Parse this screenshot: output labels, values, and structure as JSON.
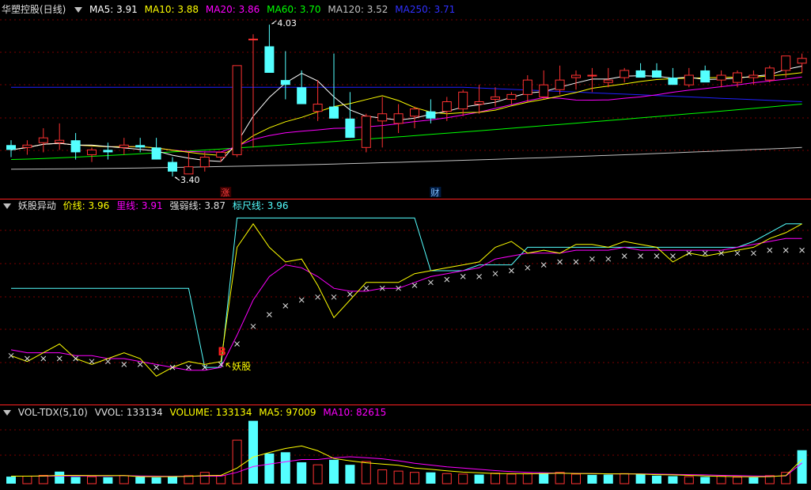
{
  "colors": {
    "bg": "#000000",
    "up": "#ff3232",
    "down": "#54ffff",
    "ma5": "#ffffff",
    "ma10": "#ffff00",
    "ma20": "#ff00ff",
    "ma60": "#00ff00",
    "ma120": "#c0c0c0",
    "ma250": "#2020ff",
    "divider": "#ff2020"
  },
  "panel1": {
    "title": "华塑控股(日线)",
    "ma5_label": "MA5: 3.91",
    "ma10_label": "MA10: 3.88",
    "ma20_label": "MA20: 3.86",
    "ma60_label": "MA60: 3.70",
    "ma120_label": "MA120: 3.52",
    "ma250_label": "MA250: 3.71",
    "high_label": "4.03",
    "low_label": "3.40",
    "marker_zhang": "涨",
    "marker_cai": "财"
  },
  "panel2": {
    "title": "妖股异动",
    "price_label": "价线: 3.96",
    "li_label": "里线: 3.91",
    "qiang_label": "强弱线: 3.87",
    "biao_label": "标尺线: 3.96",
    "signal_b": "B",
    "signal_text": "妖股"
  },
  "panel3": {
    "title": "VOL-TDX(5,10)",
    "vvol_label": "VVOL: 133134",
    "volume_label": "VOLUME: 133134",
    "ma5_label": "MA5: 97009",
    "ma10_label": "MA10: 82615"
  },
  "chart_data": [
    {
      "type": "candlestick",
      "title": "华塑控股(日线)",
      "x_index": [
        0,
        1,
        2,
        3,
        4,
        5,
        6,
        7,
        8,
        9,
        10,
        11,
        12,
        13,
        14,
        15,
        16,
        17,
        18,
        19,
        20,
        21,
        22,
        23,
        24,
        25,
        26,
        27,
        28,
        29,
        30,
        31,
        32,
        33,
        34,
        35,
        36,
        37,
        38,
        39,
        40,
        41,
        42,
        43,
        44,
        45,
        46,
        47,
        48,
        49
      ],
      "open": [
        3.53,
        3.52,
        3.54,
        3.54,
        3.55,
        3.49,
        3.51,
        3.52,
        3.53,
        3.52,
        3.46,
        3.41,
        3.44,
        3.48,
        3.49,
        3.97,
        3.94,
        3.8,
        3.77,
        3.67,
        3.69,
        3.64,
        3.52,
        3.63,
        3.62,
        3.65,
        3.67,
        3.67,
        3.68,
        3.7,
        3.72,
        3.72,
        3.74,
        3.73,
        3.76,
        3.81,
        3.82,
        3.79,
        3.81,
        3.84,
        3.84,
        3.81,
        3.78,
        3.84,
        3.8,
        3.79,
        3.81,
        3.8,
        3.84,
        3.87
      ],
      "high": [
        3.55,
        3.55,
        3.6,
        3.62,
        3.58,
        3.52,
        3.54,
        3.56,
        3.56,
        3.56,
        3.48,
        3.5,
        3.5,
        3.5,
        3.86,
        3.99,
        4.03,
        3.92,
        3.84,
        3.8,
        3.91,
        3.75,
        3.66,
        3.73,
        3.7,
        3.69,
        3.72,
        3.73,
        3.76,
        3.78,
        3.77,
        3.75,
        3.82,
        3.84,
        3.86,
        3.84,
        3.85,
        3.85,
        3.85,
        3.87,
        3.87,
        3.85,
        3.85,
        3.86,
        3.84,
        3.84,
        3.84,
        3.86,
        3.89,
        3.91
      ],
      "low": [
        3.48,
        3.49,
        3.5,
        3.51,
        3.47,
        3.46,
        3.47,
        3.49,
        3.5,
        3.47,
        3.4,
        3.41,
        3.42,
        3.46,
        3.48,
        3.52,
        3.85,
        3.72,
        3.71,
        3.63,
        3.64,
        3.56,
        3.5,
        3.52,
        3.58,
        3.6,
        3.62,
        3.63,
        3.65,
        3.66,
        3.69,
        3.7,
        3.71,
        3.72,
        3.74,
        3.76,
        3.75,
        3.77,
        3.79,
        3.82,
        3.81,
        3.78,
        3.77,
        3.8,
        3.77,
        3.77,
        3.78,
        3.79,
        3.81,
        3.83
      ],
      "close": [
        3.51,
        3.53,
        3.56,
        3.55,
        3.5,
        3.51,
        3.5,
        3.53,
        3.52,
        3.47,
        3.42,
        3.44,
        3.48,
        3.5,
        3.86,
        3.97,
        3.83,
        3.78,
        3.7,
        3.7,
        3.64,
        3.56,
        3.65,
        3.66,
        3.66,
        3.68,
        3.64,
        3.71,
        3.75,
        3.71,
        3.73,
        3.74,
        3.8,
        3.78,
        3.8,
        3.82,
        3.82,
        3.8,
        3.84,
        3.81,
        3.81,
        3.78,
        3.82,
        3.79,
        3.82,
        3.83,
        3.82,
        3.85,
        3.9,
        3.89
      ],
      "ma_last": {
        "MA5": 3.91,
        "MA10": 3.88,
        "MA20": 3.86,
        "MA60": 3.7,
        "MA120": 3.52,
        "MA250": 3.71
      },
      "annotations": [
        "4.03",
        "3.40",
        "涨",
        "财"
      ]
    },
    {
      "type": "line",
      "title": "妖股异动",
      "series": [
        {
          "name": "价线",
          "values": [
            3.51,
            3.49,
            3.52,
            3.55,
            3.5,
            3.48,
            3.5,
            3.52,
            3.5,
            3.44,
            3.47,
            3.49,
            3.48,
            3.49,
            3.88,
            3.96,
            3.88,
            3.83,
            3.84,
            3.75,
            3.64,
            3.7,
            3.76,
            3.76,
            3.76,
            3.79,
            3.8,
            3.81,
            3.82,
            3.83,
            3.88,
            3.9,
            3.86,
            3.87,
            3.86,
            3.89,
            3.89,
            3.88,
            3.9,
            3.89,
            3.88,
            3.83,
            3.86,
            3.85,
            3.86,
            3.87,
            3.88,
            3.91,
            3.93,
            3.96
          ]
        },
        {
          "name": "里线",
          "values": [
            3.53,
            3.52,
            3.52,
            3.52,
            3.51,
            3.51,
            3.5,
            3.5,
            3.49,
            3.48,
            3.47,
            3.46,
            3.46,
            3.47,
            3.58,
            3.7,
            3.78,
            3.82,
            3.81,
            3.78,
            3.74,
            3.73,
            3.73,
            3.74,
            3.74,
            3.76,
            3.78,
            3.79,
            3.8,
            3.81,
            3.84,
            3.85,
            3.86,
            3.86,
            3.86,
            3.87,
            3.87,
            3.87,
            3.88,
            3.87,
            3.87,
            3.87,
            3.87,
            3.87,
            3.87,
            3.88,
            3.89,
            3.9,
            3.91,
            3.91
          ]
        },
        {
          "name": "强弱线",
          "values": [
            3.51,
            3.5,
            3.5,
            3.5,
            3.5,
            3.49,
            3.49,
            3.48,
            3.48,
            3.47,
            3.47,
            3.47,
            3.47,
            3.48,
            3.55,
            3.61,
            3.65,
            3.68,
            3.7,
            3.71,
            3.71,
            3.72,
            3.74,
            3.74,
            3.74,
            3.75,
            3.76,
            3.77,
            3.78,
            3.78,
            3.79,
            3.8,
            3.81,
            3.82,
            3.83,
            3.83,
            3.84,
            3.84,
            3.85,
            3.85,
            3.85,
            3.85,
            3.86,
            3.86,
            3.86,
            3.86,
            3.86,
            3.87,
            3.87,
            3.87
          ]
        },
        {
          "name": "标尺线",
          "values": [
            3.74,
            3.74,
            3.74,
            3.74,
            3.74,
            3.74,
            3.74,
            3.74,
            3.74,
            3.74,
            3.74,
            3.74,
            3.47,
            3.47,
            3.98,
            3.98,
            3.98,
            3.98,
            3.98,
            3.98,
            3.98,
            3.98,
            3.98,
            3.98,
            3.98,
            3.98,
            3.8,
            3.8,
            3.8,
            3.82,
            3.82,
            3.82,
            3.88,
            3.88,
            3.88,
            3.88,
            3.88,
            3.88,
            3.88,
            3.88,
            3.88,
            3.88,
            3.88,
            3.88,
            3.88,
            3.88,
            3.9,
            3.93,
            3.96,
            3.96
          ]
        }
      ],
      "annotations": [
        "B",
        "妖股"
      ]
    },
    {
      "type": "bar",
      "title": "VOL-TDX(5,10)",
      "volume": [
        28000,
        30000,
        33000,
        48000,
        27000,
        28000,
        26000,
        32000,
        27000,
        25000,
        30000,
        32000,
        45000,
        33000,
        173000,
        250000,
        120000,
        125000,
        85000,
        75000,
        95000,
        75000,
        88000,
        55000,
        50000,
        45000,
        45000,
        40000,
        38000,
        36000,
        42000,
        38000,
        40000,
        42000,
        45000,
        38000,
        35000,
        36000,
        40000,
        38000,
        32000,
        30000,
        28000,
        27000,
        30000,
        26000,
        25000,
        32000,
        45000,
        133134
      ],
      "up_down": [
        "d",
        "u",
        "u",
        "d",
        "d",
        "u",
        "d",
        "u",
        "d",
        "d",
        "d",
        "u",
        "u",
        "u",
        "u",
        "d",
        "d",
        "d",
        "d",
        "u",
        "d",
        "d",
        "u",
        "u",
        "u",
        "u",
        "d",
        "u",
        "u",
        "d",
        "u",
        "u",
        "u",
        "d",
        "u",
        "u",
        "d",
        "d",
        "u",
        "d",
        "d",
        "d",
        "u",
        "d",
        "u",
        "u",
        "d",
        "u",
        "u",
        "d"
      ],
      "series": [
        {
          "name": "MA5",
          "values": [
            30000,
            30000,
            31000,
            33000,
            33000,
            32000,
            32000,
            32000,
            28000,
            28000,
            28000,
            29000,
            32000,
            33000,
            62000,
            106000,
            124000,
            140000,
            150000,
            131000,
            100000,
            91000,
            83000,
            78000,
            73000,
            62000,
            57000,
            51000,
            46000,
            43000,
            40000,
            40000,
            39000,
            40000,
            42000,
            40000,
            40000,
            39000,
            39000,
            38000,
            36000,
            35000,
            33000,
            31000,
            29000,
            28000,
            27000,
            28000,
            32000,
            97009
          ]
        },
        {
          "name": "MA10",
          "values": [
            30000,
            30000,
            30000,
            31000,
            31000,
            31000,
            31000,
            32000,
            31000,
            30000,
            29000,
            30000,
            30000,
            30000,
            45000,
            68000,
            78000,
            87000,
            96000,
            96000,
            103000,
            107000,
            103000,
            99000,
            91000,
            81000,
            74000,
            67000,
            62000,
            57000,
            52000,
            48000,
            45000,
            43000,
            42000,
            41000,
            40000,
            39000,
            39000,
            39000,
            38000,
            37000,
            36000,
            35000,
            33000,
            32000,
            31000,
            30000,
            31000,
            82615
          ]
        }
      ]
    }
  ]
}
